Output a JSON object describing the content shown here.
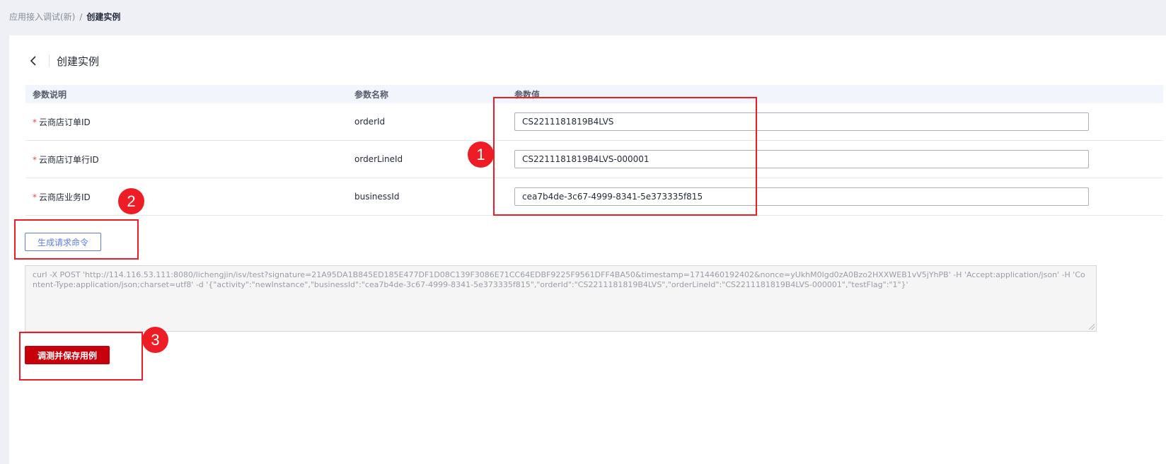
{
  "breadcrumb": {
    "parent": "应用接入调试(新)",
    "separator": "/",
    "current": "创建实例"
  },
  "page": {
    "title": "创建实例"
  },
  "table": {
    "headers": [
      "参数说明",
      "参数名称",
      "参数值"
    ],
    "rows": [
      {
        "required_mark": "*",
        "description": "云商店订单ID",
        "name": "orderId",
        "value": "CS2211181819B4LVS"
      },
      {
        "required_mark": "*",
        "description": "云商店订单行ID",
        "name": "orderLineId",
        "value": "CS2211181819B4LVS-000001"
      },
      {
        "required_mark": "*",
        "description": "云商店业务ID",
        "name": "businessId",
        "value": "cea7b4de-3c67-4999-8341-5e373335f815"
      }
    ]
  },
  "actions": {
    "generate_label": "生成请求命令",
    "save_label": "调测并保存用例"
  },
  "command_text": "curl -X POST 'http://114.116.53.111:8080/lichengjin/isv/test?signature=21A95DA1B845ED185E477DF1D08C139F3086E71CC64EDBF9225F9561DFF4BA50&timestamp=1714460192402&nonce=yUkhM0lgd0zA0Bzo2HXXWEB1vV5jYhPB' -H 'Accept:application/json' -H 'Content-Type:application/json;charset=utf8' -d '{\"activity\":\"newInstance\",\"businessId\":\"cea7b4de-3c67-4999-8341-5e373335f815\",\"orderId\":\"CS2211181819B4LVS\",\"orderLineId\":\"CS2211181819B4LVS-000001\",\"testFlag\":\"1\"}'",
  "annotations": {
    "markers": [
      "1",
      "2",
      "3"
    ],
    "color": "#ee1c25"
  },
  "colors": {
    "primary": "#5e7ce0",
    "danger_button": "#c7000b",
    "required": "#e44b4b"
  },
  "icons": {
    "back": "chevron-left-icon"
  }
}
